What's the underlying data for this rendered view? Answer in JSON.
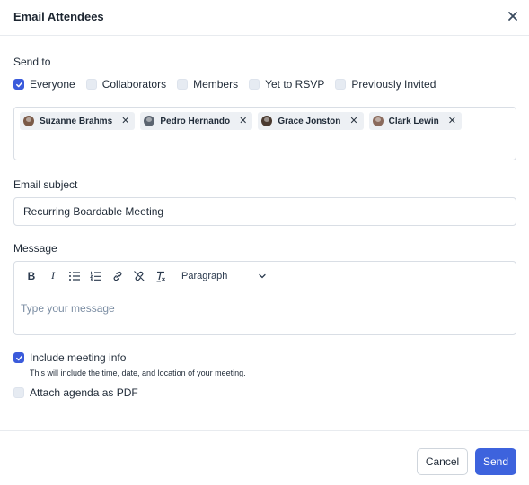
{
  "dialog": {
    "title": "Email Attendees",
    "close_icon": "close-icon"
  },
  "send_to": {
    "label": "Send to",
    "options": [
      {
        "label": "Everyone",
        "checked": true
      },
      {
        "label": "Collaborators",
        "checked": false
      },
      {
        "label": "Members",
        "checked": false
      },
      {
        "label": "Yet to RSVP",
        "checked": false
      },
      {
        "label": "Previously Invited",
        "checked": false
      }
    ]
  },
  "recipients": [
    {
      "name": "Suzanne Brahms",
      "avatar_color": "#7a5a48",
      "remove_icon": "close-icon"
    },
    {
      "name": "Pedro Hernando",
      "avatar_color": "#5b6470",
      "remove_icon": "close-icon"
    },
    {
      "name": "Grace Jonston",
      "avatar_color": "#4a3a30",
      "remove_icon": "close-icon"
    },
    {
      "name": "Clark Lewin",
      "avatar_color": "#8a6a5c",
      "remove_icon": "close-icon"
    }
  ],
  "subject": {
    "label": "Email subject",
    "value": "Recurring Boardable Meeting"
  },
  "message": {
    "label": "Message",
    "placeholder": "Type your message",
    "toolbar": {
      "bold": "B",
      "italic": "I",
      "paragraph": "Paragraph"
    }
  },
  "include_info": {
    "label": "Include meeting info",
    "checked": true,
    "help": "This will include the time, date, and location of your meeting."
  },
  "attach_agenda": {
    "label": "Attach agenda as PDF",
    "checked": false
  },
  "footer": {
    "cancel": "Cancel",
    "send": "Send"
  },
  "colors": {
    "accent": "#3d63dd",
    "checkbox_checked": "#3b5bdb",
    "checkbox_unchecked": "#e6ebf2",
    "chip_bg": "#edf0f4",
    "placeholder": "#7b8da3"
  }
}
